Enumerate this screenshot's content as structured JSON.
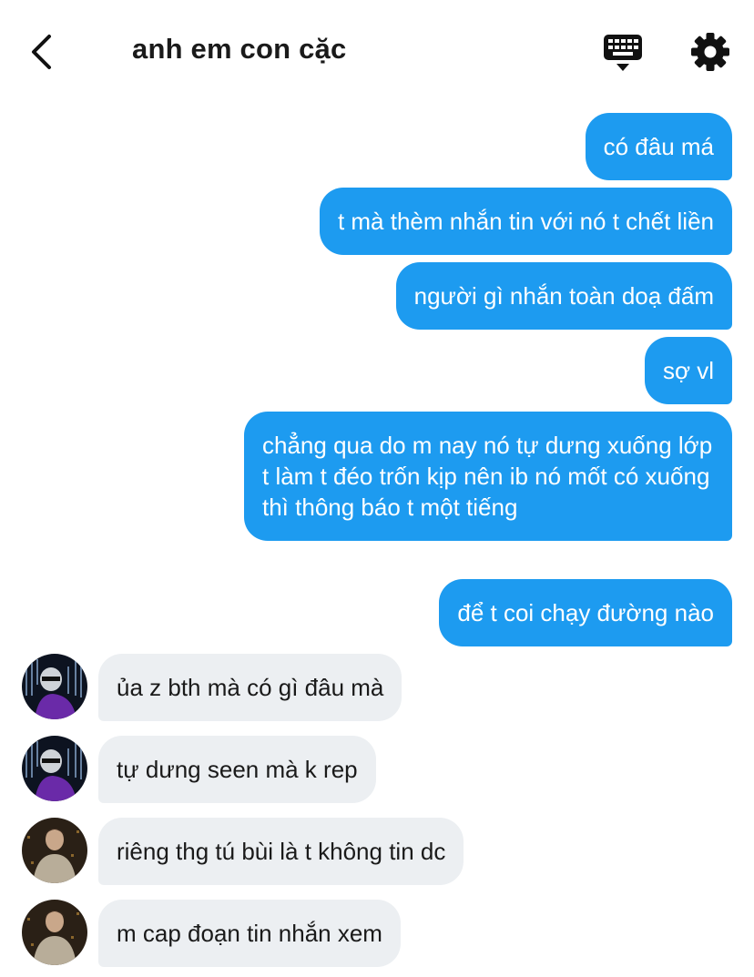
{
  "header": {
    "title": "anh em con cặc",
    "back_icon": "chevron-left-icon",
    "keyboard_icon": "keyboard-icon",
    "settings_icon": "gear-icon"
  },
  "colors": {
    "outgoing_bubble": "#1d9bf0",
    "incoming_bubble": "#eceff2"
  },
  "messages": [
    {
      "side": "out",
      "text": "có đâu má"
    },
    {
      "side": "out",
      "text": "t mà thèm nhắn tin với nó t chết liền"
    },
    {
      "side": "out",
      "text": "người gì nhắn toàn doạ đấm"
    },
    {
      "side": "out",
      "text": "sợ vl"
    },
    {
      "side": "out",
      "text": "chẳng qua do m nay nó tự dưng xuống lớp t làm t đéo trốn kịp nên ib nó mốt có xuống thì thông báo t một tiếng"
    },
    {
      "side": "out",
      "text": "để t coi chạy đường nào"
    },
    {
      "side": "in",
      "text": "ủa z bth mà có gì đâu mà"
    },
    {
      "side": "in",
      "text": "tự dưng seen mà k rep"
    },
    {
      "side": "in",
      "text": "riêng thg tú bùi là t không tin dc"
    },
    {
      "side": "in",
      "text": "m cap đoạn tin nhắn xem"
    }
  ]
}
